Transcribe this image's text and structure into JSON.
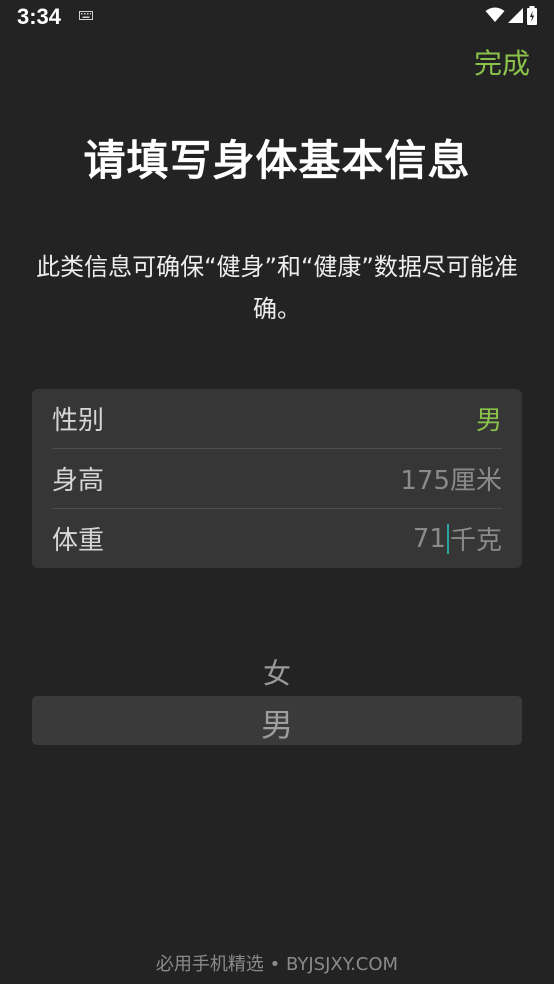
{
  "status_bar": {
    "time": "3:34",
    "icons": [
      "keyboard-icon",
      "wifi-icon",
      "signal-icon",
      "battery-icon"
    ]
  },
  "header": {
    "done_label": "完成"
  },
  "title": "请填写身体基本信息",
  "description": "此类信息可确保“健身”和“健康”数据尽可能准确。",
  "form": {
    "rows": [
      {
        "label": "性别",
        "value": "男"
      },
      {
        "label": "身高",
        "value": "175厘米"
      },
      {
        "label": "体重",
        "value_number": "71",
        "value_unit": "千克"
      }
    ]
  },
  "picker": {
    "options": [
      "女",
      "男"
    ],
    "selected": "男"
  },
  "watermark": "必用手机精选 • BYJSJXY.COM",
  "colors": {
    "accent": "#8bc34a",
    "background": "#232323",
    "card": "#363636",
    "cursor": "#26a69a"
  }
}
